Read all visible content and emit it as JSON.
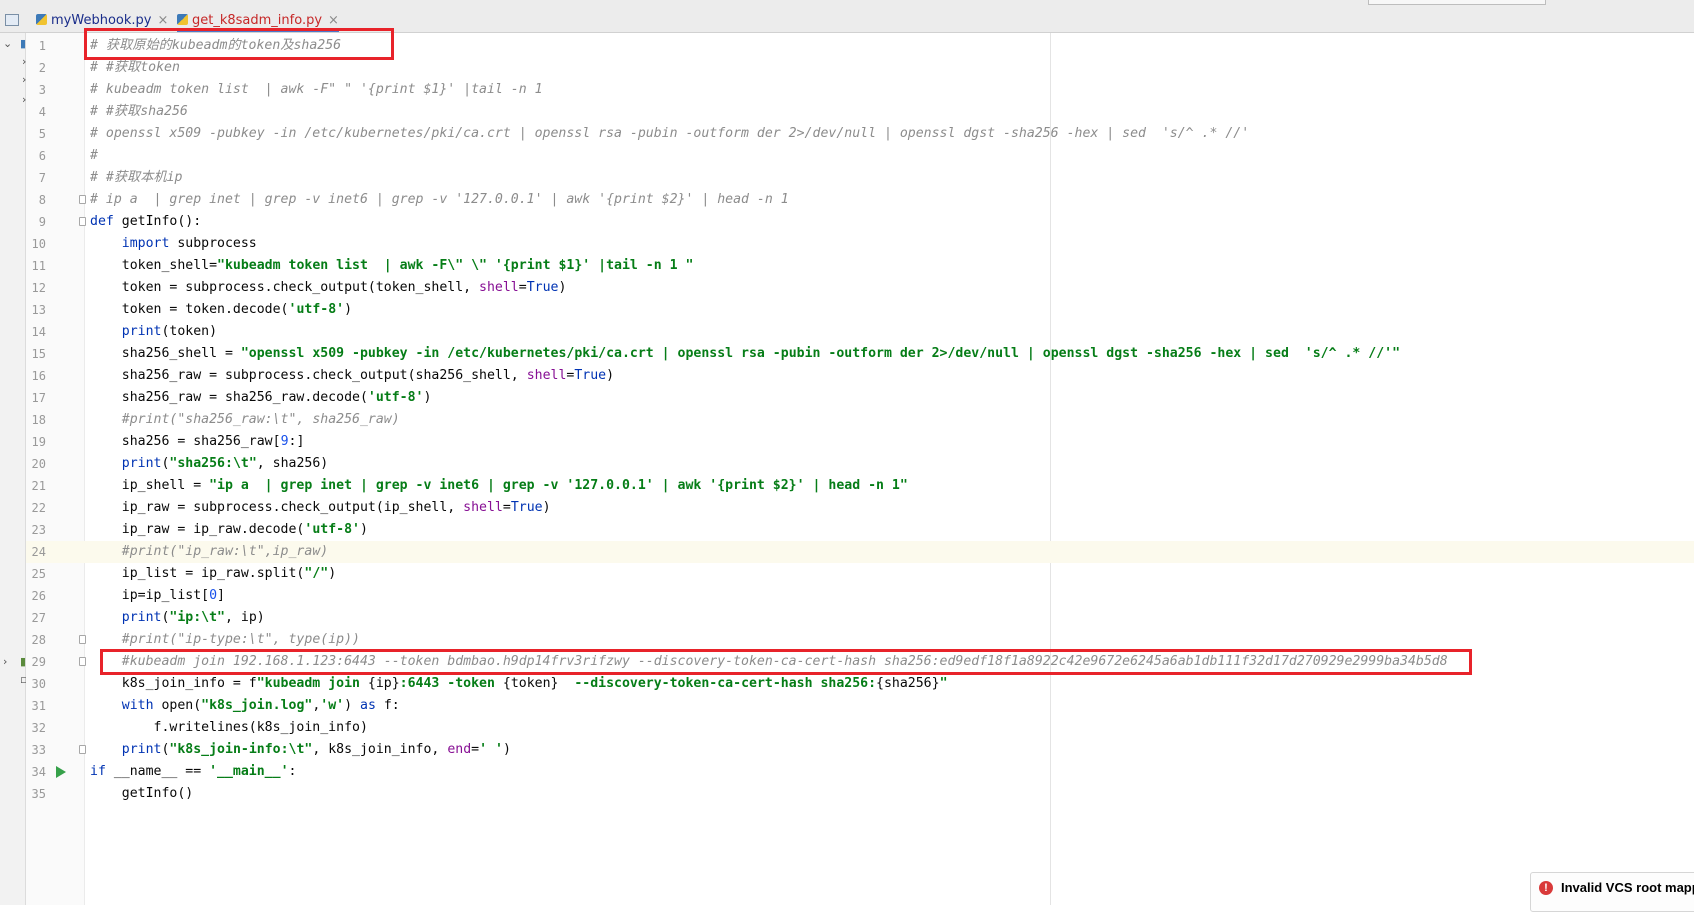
{
  "tabs": [
    {
      "label": "myWebhook.py",
      "close": "×"
    },
    {
      "label": "get_k8sadm_info.py",
      "close": "×"
    }
  ],
  "notification": {
    "icon": "!",
    "message": "Invalid VCS root mapp"
  },
  "editor": {
    "current_line": 24,
    "lines": [
      {
        "n": "1",
        "html": "<span class=\"c\"># 获取原始的kubeadm的token及sha256</span>"
      },
      {
        "n": "2",
        "html": "<span class=\"c\"># #获取token</span>"
      },
      {
        "n": "3",
        "html": "<span class=\"c\"># kubeadm token list  | awk -F\" \" '{print $1}' |tail -n 1</span>"
      },
      {
        "n": "4",
        "html": "<span class=\"c\"># #获取sha256</span>"
      },
      {
        "n": "5",
        "html": "<span class=\"c\"># openssl x509 -pubkey -in /etc/kubernetes/pki/ca.crt | openssl rsa -pubin -outform der 2>/dev/null | openssl dgst -sha256 -hex | sed  's/^ .* //'</span>"
      },
      {
        "n": "6",
        "html": "<span class=\"c\">#</span>"
      },
      {
        "n": "7",
        "html": "<span class=\"c\"># #获取本机ip</span>"
      },
      {
        "n": "8",
        "html": "<span class=\"c\"># ip a  | grep inet | grep -v inet6 | grep -v '127.0.0.1' | awk '{print $2}' | head -n 1</span>"
      },
      {
        "n": "9",
        "html": "<span class=\"k\">def</span> getInfo():"
      },
      {
        "n": "10",
        "html": "    <span class=\"k\">import</span> subprocess"
      },
      {
        "n": "11",
        "html": "    token_shell=<span class=\"s\">\"kubeadm token list  | awk -F\\\" \\\" '{print $1}' |tail -n 1 \"</span>"
      },
      {
        "n": "12",
        "html": "    token = subprocess.check_output(token_shell, <span class=\"p\">shell</span>=<span class=\"k\">True</span>)"
      },
      {
        "n": "13",
        "html": "    token = token.decode(<span class=\"s\">'utf-8'</span>)"
      },
      {
        "n": "14",
        "html": "    <span class=\"k\">print</span>(token)"
      },
      {
        "n": "15",
        "html": "    sha256_shell = <span class=\"s\">\"openssl x509 -pubkey -in /etc/kubernetes/pki/ca.crt | openssl rsa -pubin -outform der 2>/dev/null | openssl dgst -sha256 -hex | sed  's/^ .* //'\"</span>"
      },
      {
        "n": "16",
        "html": "    sha256_raw = subprocess.check_output(sha256_shell, <span class=\"p\">shell</span>=<span class=\"k\">True</span>)"
      },
      {
        "n": "17",
        "html": "    sha256_raw = sha256_raw.decode(<span class=\"s\">'utf-8'</span>)"
      },
      {
        "n": "18",
        "html": "    <span class=\"c\">#print(\"sha256_raw:\\t\", sha256_raw)</span>"
      },
      {
        "n": "19",
        "html": "    sha256 = sha256_raw[<span class=\"n\">9</span>:]"
      },
      {
        "n": "20",
        "html": "    <span class=\"k\">print</span>(<span class=\"s\">\"sha256:\\t\"</span>, sha256)"
      },
      {
        "n": "21",
        "html": "    ip_shell = <span class=\"s\">\"ip a  | grep inet | grep -v inet6 | grep -v '127.0.0.1' | awk '{print $2}' | head -n 1\"</span>"
      },
      {
        "n": "22",
        "html": "    ip_raw = subprocess.check_output(ip_shell, <span class=\"p\">shell</span>=<span class=\"k\">True</span>)"
      },
      {
        "n": "23",
        "html": "    ip_raw = ip_raw.decode(<span class=\"s\">'utf-8'</span>)"
      },
      {
        "n": "24",
        "html": "    <span class=\"c\">#print(\"ip_raw:\\t\",ip_raw)</span>"
      },
      {
        "n": "25",
        "html": "    ip_list = ip_raw.split(<span class=\"s\">\"/\"</span>)"
      },
      {
        "n": "26",
        "html": "    ip=ip_list[<span class=\"n\">0</span>]"
      },
      {
        "n": "27",
        "html": "    <span class=\"k\">print</span>(<span class=\"s\">\"ip:\\t\"</span>, ip)"
      },
      {
        "n": "28",
        "html": "    <span class=\"c\">#print(\"ip-type:\\t\", type(ip))</span>"
      },
      {
        "n": "29",
        "html": "    <span class=\"c\">#kubeadm join 192.168.1.123:6443 --token bdmbao.h9dp14frv3rifzwy --discovery-token-ca-cert-hash sha256:ed9edf18f1a8922c42e9672e6245a6ab1db111f32d17d270929e2999ba34b5d8</span>"
      },
      {
        "n": "30",
        "html": "    k8s_join_info = f<span class=\"s\">\"kubeadm join </span>{ip}<span class=\"s\">:6443 -token </span>{token}<span class=\"s\">  --discovery-token-ca-cert-hash sha256:</span>{sha256}<span class=\"s\">\"</span>"
      },
      {
        "n": "31",
        "html": "    <span class=\"k\">with</span> open(<span class=\"s\">\"k8s_join.log\"</span>,<span class=\"s\">'w'</span>) <span class=\"k\">as</span> f:"
      },
      {
        "n": "32",
        "html": "        f.writelines(k8s_join_info)"
      },
      {
        "n": "33",
        "html": "    <span class=\"k\">print</span>(<span class=\"s\">\"k8s_join-info:\\t\"</span>, k8s_join_info, <span class=\"p\">end</span>=<span class=\"s\">' '</span>)"
      },
      {
        "n": "34",
        "html": "<span class=\"k\">if</span> __name__ == <span class=\"s\">'__main__'</span>:"
      },
      {
        "n": "35",
        "html": "    getInfo()"
      }
    ]
  }
}
